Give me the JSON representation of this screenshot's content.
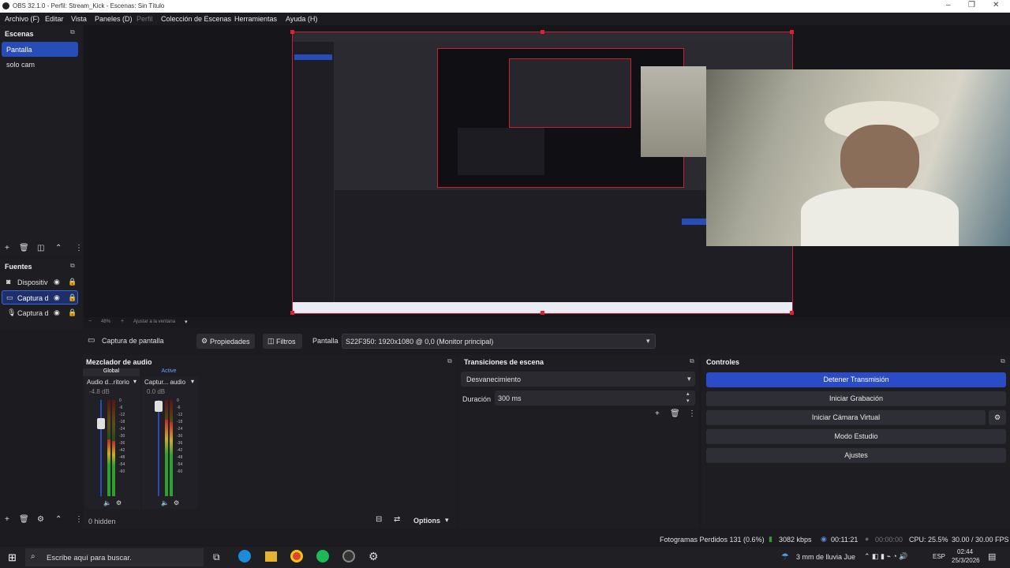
{
  "window": {
    "title": "OBS 32.1.0 - Perfil: Stream_Kick - Escenas: Sin Título",
    "minimize": "–",
    "maximize": "❐",
    "close": "✕"
  },
  "menu": [
    {
      "label": "Archivo (F)"
    },
    {
      "label": "Editar"
    },
    {
      "label": "Vista"
    },
    {
      "label": "Paneles (D)"
    },
    {
      "label": "Perfil"
    },
    {
      "label": "Colección de Escenas"
    },
    {
      "label": "Herramientas"
    },
    {
      "label": "Ayuda (H)"
    }
  ],
  "scenes": {
    "header": "Escenas",
    "items": [
      "Pantalla",
      "solo cam"
    ],
    "selected": 0
  },
  "sources": {
    "header": "Fuentes",
    "items": [
      {
        "label": "Dispositiv",
        "icon": "camera-icon"
      },
      {
        "label": "Captura d",
        "icon": "monitor-icon"
      },
      {
        "label": "Captura d",
        "icon": "microphone-icon"
      }
    ],
    "selected": 1
  },
  "preview": {
    "zoom": "48%",
    "fit_label": "Ajustar a la ventana"
  },
  "source_bar": {
    "source_name": "Captura de pantalla",
    "properties": "Propiedades",
    "filters": "Filtros",
    "display_label": "Pantalla",
    "display_value": "S22F350: 1920x1080 @ 0,0 (Monitor principal)"
  },
  "audio": {
    "header": "Mezclador de audio",
    "tab_global": "Global",
    "tab_active": "Active",
    "channels": [
      {
        "name": "Audio d...ritorio",
        "db": "-4.8 dB",
        "level": 0.5
      },
      {
        "name": "Captur... audio",
        "db": "0.0 dB",
        "level": 0.6
      }
    ],
    "scale": [
      "0",
      "-6",
      "-12",
      "-18",
      "-24",
      "-30",
      "-36",
      "-42",
      "-48",
      "-54",
      "-60"
    ],
    "hidden": "0 hidden",
    "options": "Options"
  },
  "transitions": {
    "header": "Transiciones de escena",
    "selected": "Desvanecimiento",
    "duration_label": "Duración",
    "duration_value": "300 ms"
  },
  "controls": {
    "header": "Controles",
    "stop_stream": "Detener Transmisión",
    "start_record": "Iniciar Grabación",
    "virtual_cam": "Iniciar Cámara Virtual",
    "studio_mode": "Modo Estudio",
    "settings": "Ajustes"
  },
  "status": {
    "dropped": "Fotogramas Perdidos 131 (0.6%)",
    "bitrate": "3082 kbps",
    "stream_time": "00:11:21",
    "rec_time": "00:00:00",
    "cpu": "CPU: 25.5%",
    "fps": "30.00 / 30.00 FPS"
  },
  "taskbar": {
    "search_placeholder": "Escribe aquí para buscar.",
    "weather": "3 mm de lluvia Jue",
    "lang": "ESP",
    "time": "02:44",
    "date": "25/3/2026"
  },
  "colors": {
    "accent": "#284cb8",
    "stop_button": "#2b4bc7",
    "selection_border": "#c8202c"
  }
}
